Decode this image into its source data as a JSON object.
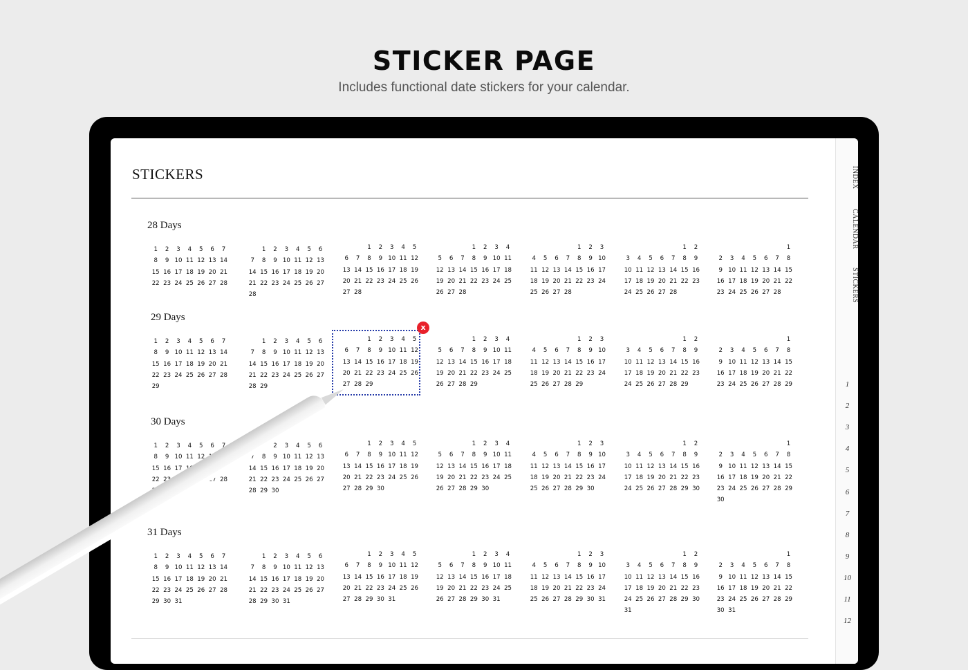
{
  "hero": {
    "title": "STICKER PAGE",
    "subtitle": "Includes functional date stickers for your calendar."
  },
  "page": {
    "title": "STICKERS"
  },
  "side_tabs": [
    "INDEX",
    "CALENDAR",
    "STICKERS"
  ],
  "months": [
    "1",
    "2",
    "3",
    "4",
    "5",
    "6",
    "7",
    "8",
    "9",
    "10",
    "11",
    "12"
  ],
  "groups": [
    {
      "label": "28 Days",
      "days": 28
    },
    {
      "label": "29 Days",
      "days": 29
    },
    {
      "label": "30 Days",
      "days": 30
    },
    {
      "label": "31 Days",
      "days": 31
    }
  ],
  "sticker_offsets": [
    0,
    1,
    2,
    3,
    4,
    5,
    6
  ],
  "selected_sticker": {
    "group": "29 Days",
    "offset": 2
  },
  "close_label": "x",
  "colors": {
    "selection": "#2439a8",
    "close": "#e8202a"
  }
}
